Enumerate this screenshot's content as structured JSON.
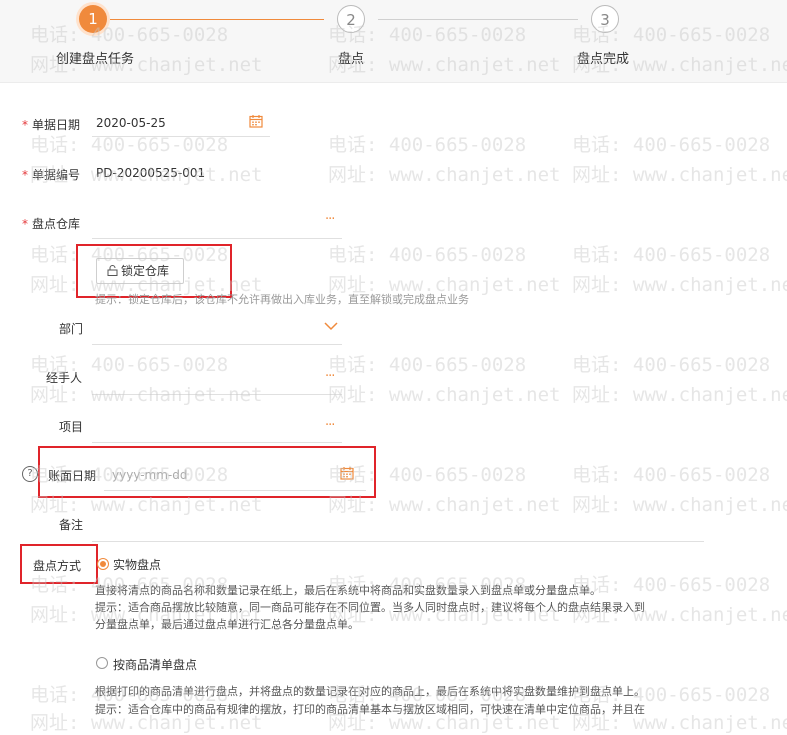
{
  "steps": [
    {
      "number": "1",
      "label": "创建盘点任务"
    },
    {
      "number": "2",
      "label": "盘点"
    },
    {
      "number": "3",
      "label": "盘点完成"
    }
  ],
  "form": {
    "doc_date": {
      "label": "单据日期",
      "value": "2020-05-25"
    },
    "doc_number": {
      "label": "单据编号",
      "value": "PD-20200525-001"
    },
    "warehouse": {
      "label": "盘点仓库",
      "lock_button": "锁定仓库",
      "hint": "提示：锁定仓库后，该仓库不允许再做出入库业务，直至解锁或完成盘点业务"
    },
    "department": {
      "label": "部门"
    },
    "handler": {
      "label": "经手人"
    },
    "project": {
      "label": "项目"
    },
    "book_date": {
      "label": "账面日期",
      "placeholder": "yyyy-mm-dd"
    },
    "remark": {
      "label": "备注"
    },
    "method": {
      "label": "盘点方式",
      "options": [
        {
          "label": "实物盘点",
          "selected": true,
          "desc": [
            "直接将清点的商品名称和数量记录在纸上，最后在系统中将商品和实盘数量录入到盘点单或分量盘点单。",
            "提示：适合商品摆放比较随意，同一商品可能存在不同位置。当多人同时盘点时，建议将每个人的盘点结果录入到",
            "分量盘点单，最后通过盘点单进行汇总各分量盘点单。"
          ]
        },
        {
          "label": "按商品清单盘点",
          "selected": false,
          "desc": [
            "根据打印的商品清单进行盘点，并将盘点的数量记录在对应的商品上，最后在系统中将实盘数量维护到盘点单上。",
            "提示：适合仓库中的商品有规律的摆放，打印的商品清单基本与摆放区域相同，可快速在清单中定位商品，并且在"
          ]
        }
      ]
    }
  },
  "watermark": {
    "phone": "电话: 400-665-0028",
    "site": "网址: www.chanjet.net"
  },
  "colors": {
    "accent": "#f08a3c",
    "highlight": "#e0242a",
    "required": "#e4393c"
  }
}
